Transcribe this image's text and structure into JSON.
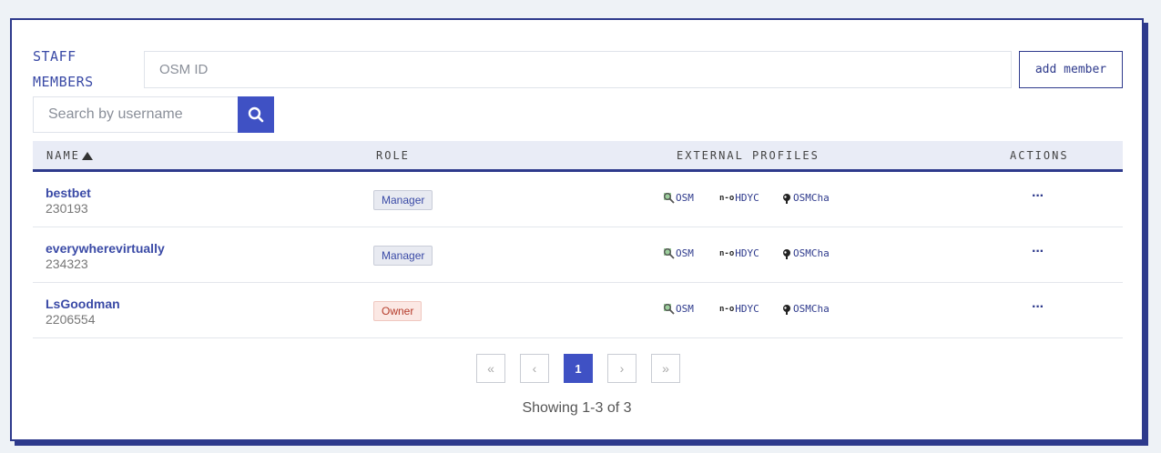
{
  "header": {
    "title_line1": "STAFF",
    "title_line2": "MEMBERS",
    "osm_id_placeholder": "OSM ID",
    "add_member_label": "add member"
  },
  "search": {
    "placeholder": "Search by username"
  },
  "table": {
    "columns": {
      "name": "NAME",
      "role": "ROLE",
      "external_profiles": "EXTERNAL PROFILES",
      "actions": "ACTIONS"
    },
    "sort": {
      "column": "name",
      "direction": "ascending"
    },
    "rows": [
      {
        "username": "bestbet",
        "id": "230193",
        "role": "Manager"
      },
      {
        "username": "everywherevirtually",
        "id": "234323",
        "role": "Manager"
      },
      {
        "username": "LsGoodman",
        "id": "2206554",
        "role": "Owner"
      }
    ],
    "external_links": {
      "osm": "OSM",
      "hdyc": "HDYC",
      "osmcha": "OSMCha",
      "hdyc_mark": "n-o"
    },
    "actions_label": "···"
  },
  "pagination": {
    "first": "«",
    "prev": "‹",
    "current": "1",
    "next": "›",
    "last": "»",
    "showing": "Showing 1-3 of 3"
  },
  "colors": {
    "accent": "#3f51c4",
    "navy": "#2e3a8c",
    "background": "#eef2f6",
    "owner_badge": "#fbe8e4",
    "manager_badge": "#e8eaf1"
  }
}
